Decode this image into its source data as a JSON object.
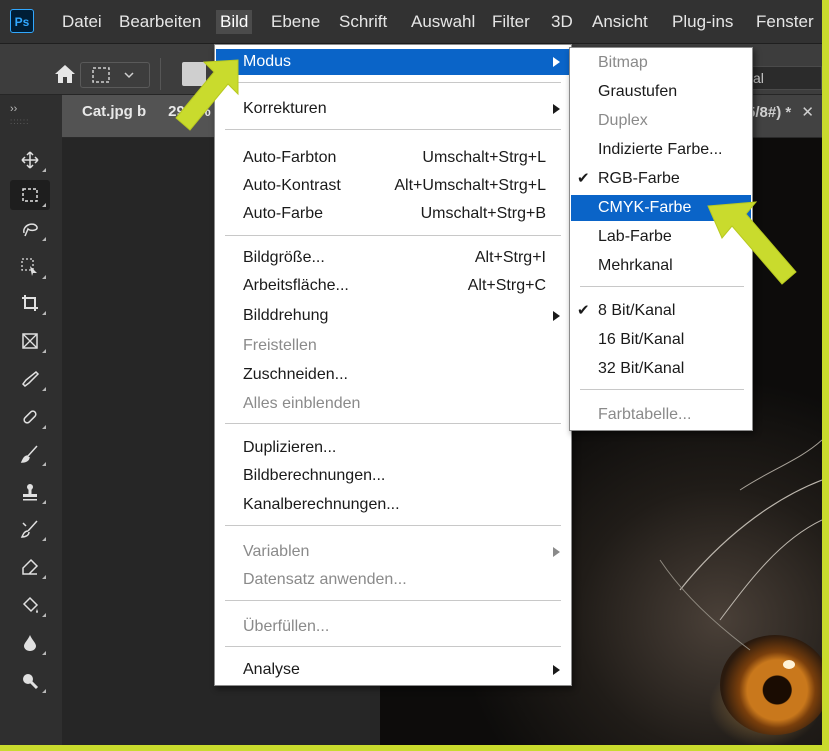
{
  "app": {
    "logo": "Ps"
  },
  "menubar": {
    "items": [
      "Datei",
      "Bearbeiten",
      "Bild",
      "Ebene",
      "Schrift",
      "Auswahl",
      "Filter",
      "3D",
      "Ansicht",
      "Plug-ins",
      "Fenster"
    ]
  },
  "options": {
    "right_select": "al"
  },
  "document": {
    "tab_label": "Cat.jpg b",
    "tab_zoom": "29,2%",
    "tab_suffix": "5/8#) *"
  },
  "toolbar": {
    "icons": [
      "move-icon",
      "marquee-icon",
      "lasso-icon",
      "object-select-icon",
      "crop-icon",
      "frame-icon",
      "eyedropper-icon",
      "healing-brush-icon",
      "brush-icon",
      "stamp-icon",
      "history-brush-icon",
      "eraser-icon",
      "paint-bucket-icon",
      "blur-icon",
      "dodge-icon"
    ]
  },
  "bild_menu": {
    "modus": "Modus",
    "korrekturen": "Korrekturen",
    "auto_farbton": {
      "label": "Auto-Farbton",
      "shortcut": "Umschalt+Strg+L"
    },
    "auto_kontrast": {
      "label": "Auto-Kontrast",
      "shortcut": "Alt+Umschalt+Strg+L"
    },
    "auto_farbe": {
      "label": "Auto-Farbe",
      "shortcut": "Umschalt+Strg+B"
    },
    "bildgroesse": {
      "label": "Bildgröße...",
      "shortcut": "Alt+Strg+I"
    },
    "arbeitsflaeche": {
      "label": "Arbeitsfläche...",
      "shortcut": "Alt+Strg+C"
    },
    "bilddrehung": "Bilddrehung",
    "freistellen": "Freistellen",
    "zuschneiden": "Zuschneiden...",
    "alles_einblenden": "Alles einblenden",
    "duplizieren": "Duplizieren...",
    "bildberechnungen": "Bildberechnungen...",
    "kanalberechnungen": "Kanalberechnungen...",
    "variablen": "Variablen",
    "datensatz": "Datensatz anwenden...",
    "ueberfuellen": "Überfüllen...",
    "analyse": "Analyse"
  },
  "modus_menu": {
    "bitmap": "Bitmap",
    "graustufen": "Graustufen",
    "duplex": "Duplex",
    "indizierte": "Indizierte Farbe...",
    "rgb": "RGB-Farbe",
    "cmyk": "CMYK-Farbe",
    "lab": "Lab-Farbe",
    "mehrkanal": "Mehrkanal",
    "bit8": "8 Bit/Kanal",
    "bit16": "16 Bit/Kanal",
    "bit32": "32 Bit/Kanal",
    "farbtabelle": "Farbtabelle...",
    "checkmark": "✔"
  },
  "colors": {
    "highlight": "#0a64c8",
    "annotation": "#c9db2d"
  }
}
